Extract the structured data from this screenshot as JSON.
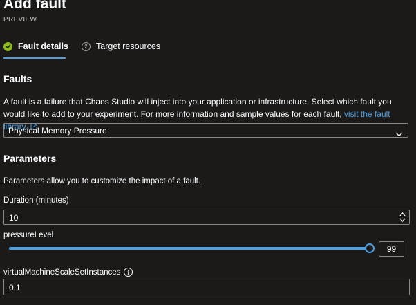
{
  "header": {
    "title": "Add fault",
    "subtitle": "PREVIEW"
  },
  "tabs": [
    {
      "label": "Fault details",
      "state": "completed",
      "selected": true
    },
    {
      "label": "Target resources",
      "step": "2",
      "selected": false
    }
  ],
  "faults": {
    "title": "Faults",
    "description": "A fault is a failure that Chaos Studio will inject into your application or infrastructure. Select which fault you would like to add to your experiment. For more information and sample values for each fault, ",
    "link_text": "visit the fault library.",
    "link_icon": "external-link-icon",
    "selected_fault": "Physical Memory Pressure"
  },
  "parameters": {
    "title": "Parameters",
    "description": "Parameters allow you to customize the impact of a fault.",
    "duration": {
      "label": "Duration (minutes)",
      "value": "10"
    },
    "pressure": {
      "label": "pressureLevel",
      "value": "99",
      "min": 0,
      "max": 99,
      "fraction": 1.0
    },
    "vmss": {
      "label": "virtualMachineScaleSetInstances",
      "value": "0,1",
      "info_icon": "info-icon"
    }
  },
  "colors": {
    "accent": "#4aa0e6",
    "success": "#8cbd18",
    "background": "#1b1a19",
    "border": "#8a8886"
  }
}
